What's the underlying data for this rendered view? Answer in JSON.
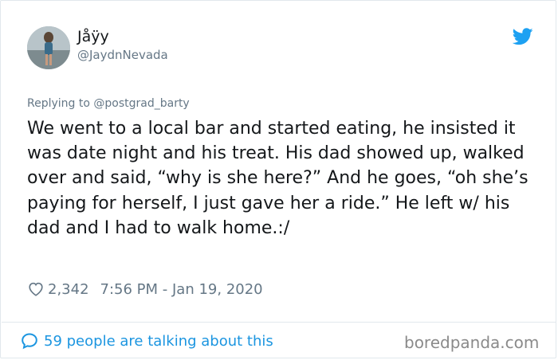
{
  "user": {
    "display_name": "Jåÿy",
    "handle": "@JaydnNevada"
  },
  "tweet": {
    "replying_to": "Replying to @postgrad_barty",
    "text": "We went to a local bar and started eating, he insisted it was date night and his treat. His dad showed up, walked over and said, “why is she here?” And he goes, “oh she’s paying for herself, I just gave her a ride.” He left w/ his dad and I had to walk home.:/",
    "likes": "2,342",
    "timestamp": "7:56 PM - Jan 19, 2020"
  },
  "footer": {
    "talking": "59 people are talking about this",
    "watermark": "boredpanda.com"
  },
  "icons": {
    "brand": "twitter-bird-icon",
    "like": "heart-icon",
    "talk": "speech-bubble-icon"
  },
  "colors": {
    "accent": "#1da1f2",
    "link": "#1b95e0",
    "muted": "#657786"
  }
}
